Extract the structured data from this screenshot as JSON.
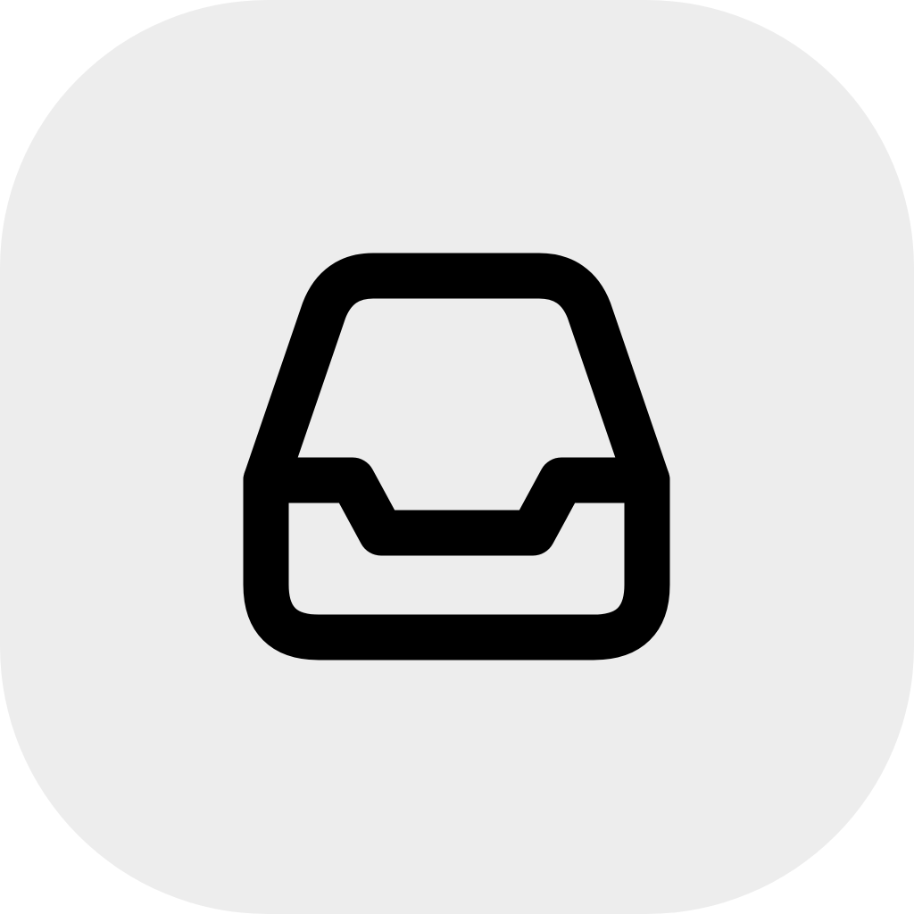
{
  "tile": {
    "background_color": "#ededed",
    "icon_name": "inbox-icon",
    "icon_color": "#000000"
  }
}
